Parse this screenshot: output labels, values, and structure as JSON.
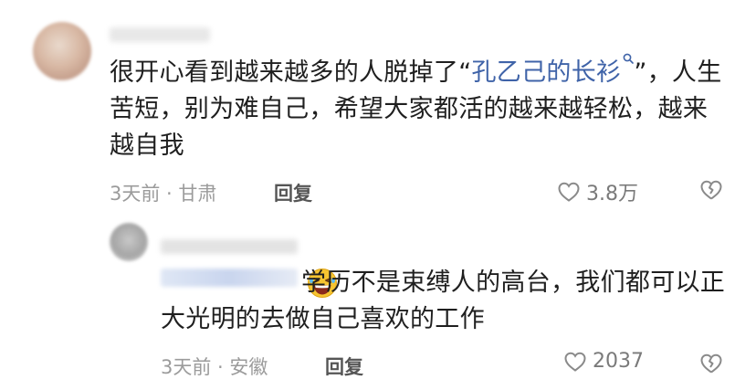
{
  "comment": {
    "text_before": "很开心看到越来越多的人脱掉了“",
    "link_text": "孔乙己的长衫",
    "text_after": "”，人生苦短，别为难自己，希望大家都活的越来越轻松，越来越自我",
    "time_location": "3天前 · 甘肃",
    "reply_label": "回复",
    "likes": "3.8万"
  },
  "reply": {
    "text": "学历不是束缚人的高台，我们都可以正大光明的去做自己喜欢的工作",
    "time_location": "3天前 · 安徽",
    "reply_label": "回复",
    "likes": "2037"
  },
  "icons": {
    "like": "heart-outline-icon",
    "dislike": "broken-heart-icon",
    "search": "search-icon",
    "emoji": "laughing-emoji-icon"
  },
  "colors": {
    "link": "#3f63a8",
    "meta": "#9b9b9b",
    "text": "#1f1f1f"
  }
}
